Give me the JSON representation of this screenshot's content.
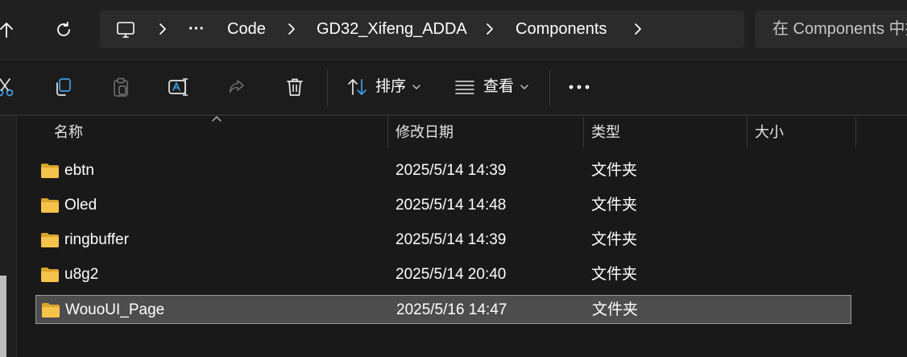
{
  "nav": {
    "up_icon": "arrow-up-icon",
    "refresh_icon": "refresh-icon"
  },
  "address_bar": {
    "computer_icon": "computer-icon",
    "overflow": "···",
    "crumbs": [
      "Code",
      "GD32_Xifeng_ADDA",
      "Components"
    ]
  },
  "search": {
    "placeholder": "在 Components 中搜索"
  },
  "toolbar": {
    "cut_icon": "scissors-icon",
    "copy_icon": "copy-icon",
    "paste_icon": "paste-icon",
    "rename_icon": "rename-icon",
    "share_icon": "share-icon",
    "delete_icon": "trash-icon",
    "sort_label": "排序",
    "view_label": "查看",
    "more_icon": "ellipsis-icon"
  },
  "columns": {
    "name": "名称",
    "modified": "修改日期",
    "type": "类型",
    "size": "大小"
  },
  "files": [
    {
      "name": "ebtn",
      "modified": "2025/5/14 14:39",
      "type": "文件夹",
      "size": ""
    },
    {
      "name": "Oled",
      "modified": "2025/5/14 14:48",
      "type": "文件夹",
      "size": ""
    },
    {
      "name": "ringbuffer",
      "modified": "2025/5/14 14:39",
      "type": "文件夹",
      "size": ""
    },
    {
      "name": "u8g2",
      "modified": "2025/5/14 20:40",
      "type": "文件夹",
      "size": ""
    },
    {
      "name": "WouoUI_Page",
      "modified": "2025/5/16 14:47",
      "type": "文件夹",
      "size": "",
      "selected": true
    }
  ],
  "colors": {
    "background": "#191919",
    "selection": "#4d4d4d",
    "folder": "#f4c34a"
  }
}
